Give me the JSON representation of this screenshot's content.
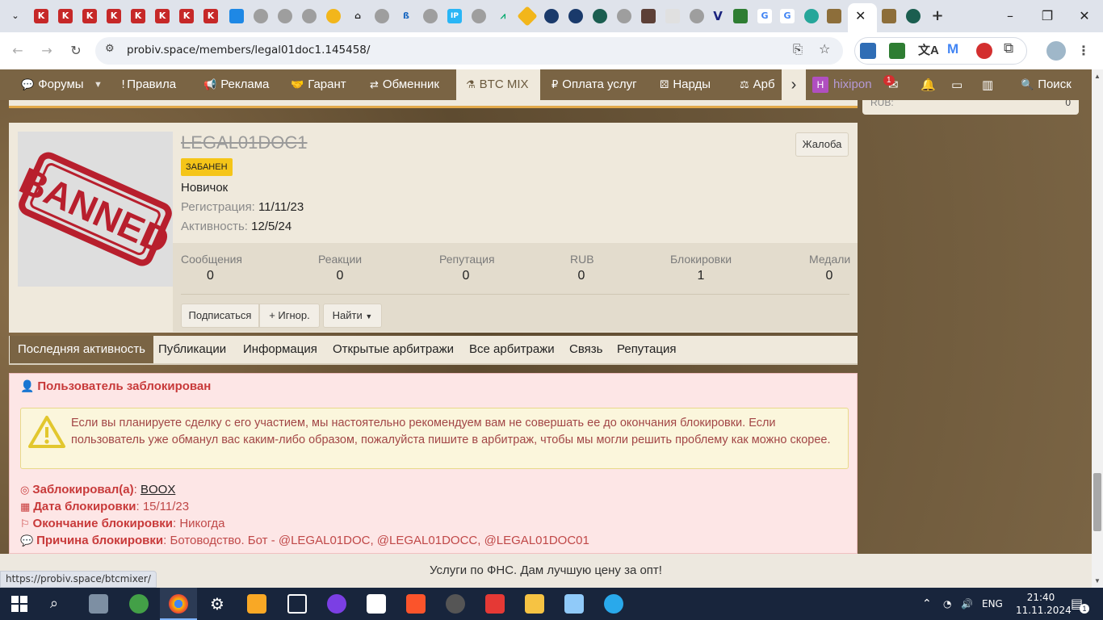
{
  "browser": {
    "url": "probiv.space/members/legal01doc1.145458/",
    "status_url": "https://probiv.space/btcmixer/",
    "tab_icons": [
      "K",
      "K",
      "K",
      "K",
      "K",
      "K",
      "K",
      "K"
    ],
    "new_tab": "+",
    "ext_badge": "1"
  },
  "nav": {
    "items": [
      {
        "icon": "speech-icon",
        "label": "Форумы"
      },
      {
        "icon": "exclamation-icon",
        "label": "Правила"
      },
      {
        "icon": "megaphone-icon",
        "label": "Реклама"
      },
      {
        "icon": "handshake-icon",
        "label": "Гарант"
      },
      {
        "icon": "exchange-icon",
        "label": "Обменник"
      },
      {
        "icon": "flask-icon",
        "label": "BTC MIX"
      },
      {
        "icon": "ruble-icon",
        "label": "Оплата услуг"
      },
      {
        "icon": "dice-icon",
        "label": "Нарды"
      },
      {
        "icon": "scales-icon",
        "label": "Арб"
      }
    ],
    "user_initial": "H",
    "username": "hixipon",
    "inbox_badge": "1",
    "search_label": "Поиск"
  },
  "sidebar": {
    "rub_label": "RUB:",
    "rub_value": "0"
  },
  "profile": {
    "username": "LEGAL01DOC1",
    "banned_badge": "ЗАБАНЕН",
    "rank": "Новичок",
    "registered_label": "Регистрация:",
    "registered_value": "11/11/23",
    "activity_label": "Активность:",
    "activity_value": "12/5/24",
    "report_button": "Жалоба",
    "avatar_stamp": "BANNED",
    "stats": [
      {
        "label": "Сообщения",
        "value": "0"
      },
      {
        "label": "Реакции",
        "value": "0"
      },
      {
        "label": "Репутация",
        "value": "0"
      },
      {
        "label": "RUB",
        "value": "0"
      },
      {
        "label": "Блокировки",
        "value": "1"
      },
      {
        "label": "Медали",
        "value": "0"
      }
    ],
    "subscribe_button": "Подписаться",
    "ignore_button": "+ Игнор.",
    "find_button": "Найти"
  },
  "tabs": [
    "Последняя активность",
    "Публикации",
    "Информация",
    "Открытые арбитражи",
    "Все арбитражи",
    "Связь",
    "Репутация"
  ],
  "ban": {
    "title": "Пользователь заблокирован",
    "warning": "Если вы планируете сделку с его участием, мы настоятельно рекомендуем вам не совершать ее до окончания блокировки. Если пользователь уже обманул вас каким-либо образом, пожалуйста пишите в арбитраж, чтобы мы могли решить проблему как можно скорее.",
    "blocked_by_label": "Заблокировал(а)",
    "blocked_by_value": "BOOX",
    "date_label": "Дата блокировки",
    "date_value": "15/11/23",
    "end_label": "Окончание блокировки",
    "end_value": "Никогда",
    "reason_label": "Причина блокировки",
    "reason_value": "Ботоводство. Бот - @LEGAL01DOC, @LEGAL01DOCC, @LEGAL01DOC01"
  },
  "ad": {
    "text": "Услуги по ФНС. Дам лучшую цену за опт!"
  },
  "taskbar": {
    "lang": "ENG",
    "time": "21:40",
    "date": "11.11.2024",
    "notif_count": "1"
  },
  "colors": {
    "brand": "#7a6444",
    "ban_red": "#c83a3a",
    "badge_yellow": "#f5c518"
  }
}
